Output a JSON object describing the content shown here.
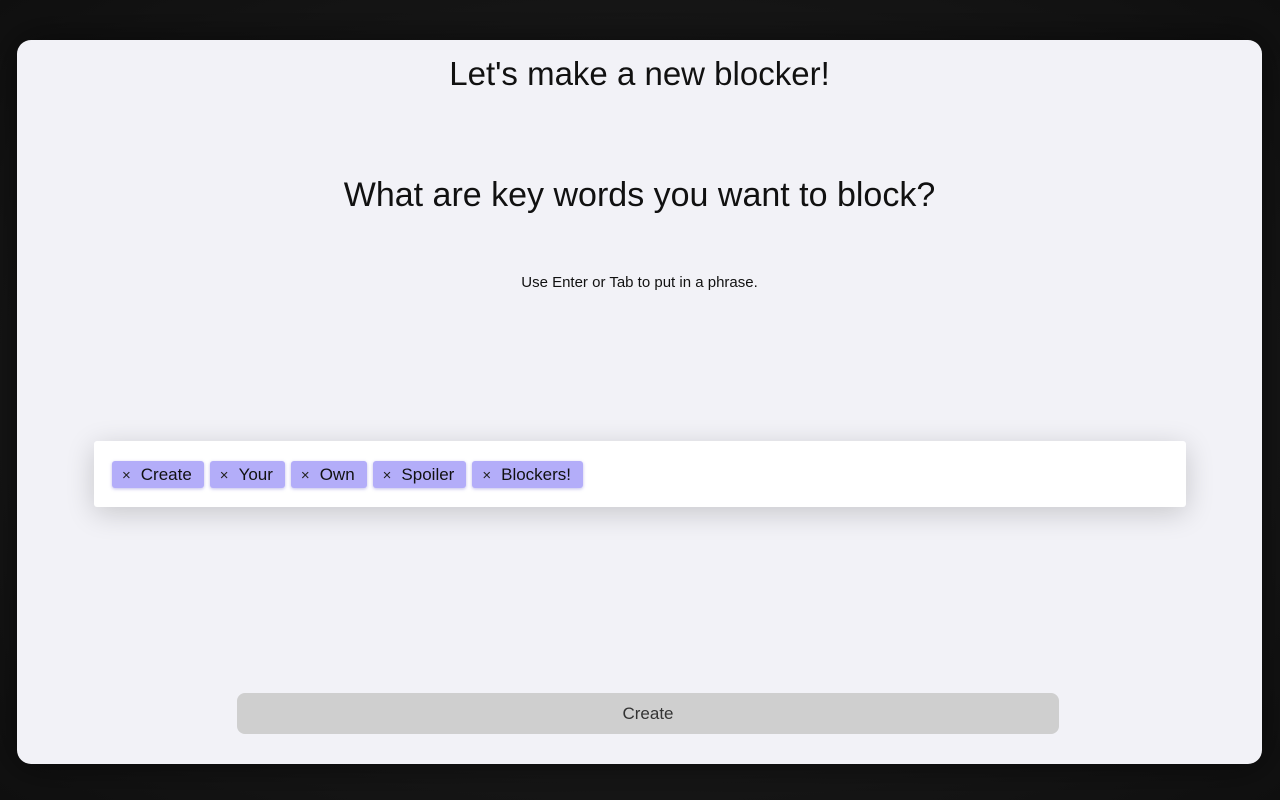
{
  "header": {
    "title": "Let's make a new blocker!"
  },
  "main": {
    "question": "What are key words you want to block?",
    "hint": "Use Enter or Tab to put in a phrase.",
    "tags": [
      {
        "remove_symbol": "×",
        "label": "Create"
      },
      {
        "remove_symbol": "×",
        "label": "Your"
      },
      {
        "remove_symbol": "×",
        "label": "Own"
      },
      {
        "remove_symbol": "×",
        "label": "Spoiler"
      },
      {
        "remove_symbol": "×",
        "label": "Blockers!"
      }
    ],
    "tag_input_value": "",
    "tag_input_placeholder": ""
  },
  "footer": {
    "create_label": "Create"
  },
  "colors": {
    "window_background": "#f2f2f7",
    "tag_background": "#b3adf9",
    "button_background": "#cfcfcf"
  }
}
